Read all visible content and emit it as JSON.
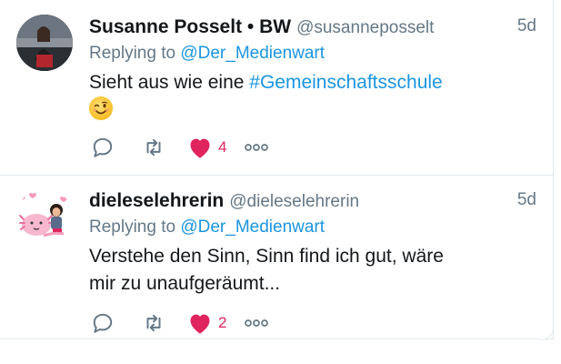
{
  "tweets": [
    {
      "display_name": "Susanne Posselt • BW",
      "handle": "@susanneposselt",
      "time": "5d",
      "replying_prefix": "Replying to",
      "replying_to": "@Der_Medienwart",
      "text_before": "Sieht aus wie eine ",
      "hashtag": "#Gemeinschaftsschule",
      "emoji": "winking-face-emoji",
      "likes": "4",
      "liked": true
    },
    {
      "display_name": "dieleselehrerin",
      "handle": "@dieleselehrerin",
      "time": "5d",
      "replying_prefix": "Replying to",
      "replying_to": "@Der_Medienwart",
      "text_line1": "Verstehe den Sinn, Sinn find ich gut, wäre",
      "text_line2": "mir zu unaufgeräumt...",
      "likes": "2",
      "liked": true
    }
  ],
  "colors": {
    "name": "#14171a",
    "meta": "#657786",
    "link": "#1b95e0",
    "like": "#e0245e",
    "border": "#e1e8ed"
  }
}
